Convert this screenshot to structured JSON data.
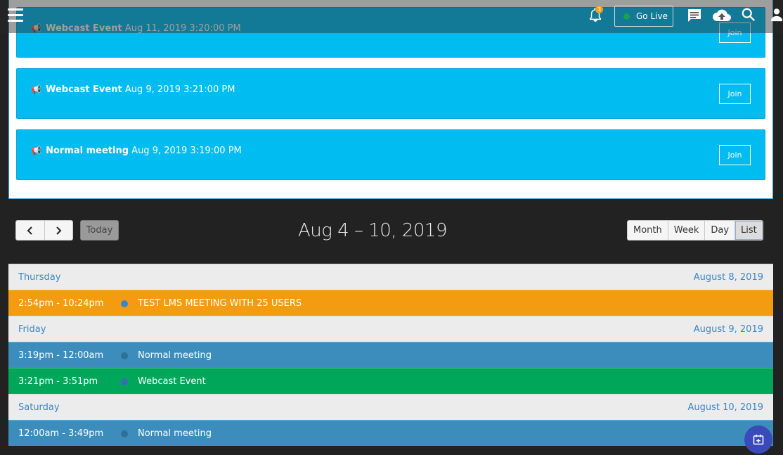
{
  "topbar": {
    "notification_count": "3",
    "go_live_label": "Go Live",
    "icons": [
      "menu-icon",
      "bell-icon",
      "chat-icon",
      "cloud-upload-icon",
      "search-icon",
      "user-icon"
    ]
  },
  "events": [
    {
      "title": "Webcast Event",
      "datetime": "Aug 11, 2019 3:20:00 PM",
      "join_label": "Join"
    },
    {
      "title": "Webcast Event",
      "datetime": "Aug 9, 2019 3:21:00 PM",
      "join_label": "Join"
    },
    {
      "title": "Normal meeting",
      "datetime": "Aug 9, 2019 3:19:00 PM",
      "join_label": "Join"
    }
  ],
  "calendar": {
    "today_label": "Today",
    "range_title": "Aug 4 – 10, 2019",
    "views": [
      "Month",
      "Week",
      "Day",
      "List"
    ],
    "active_view": "List",
    "days": [
      {
        "name": "Thursday",
        "date": "August 8, 2019",
        "events": [
          {
            "time": "2:54pm - 10:24pm",
            "title": "TEST LMS MEETING WITH 25 USERS",
            "color": "#f39c12",
            "dot": "#3a87c6"
          }
        ]
      },
      {
        "name": "Friday",
        "date": "August 9, 2019",
        "events": [
          {
            "time": "3:19pm - 12:00am",
            "title": "Normal meeting",
            "color": "#3c8dbc",
            "dot": "#2f6f99"
          },
          {
            "time": "3:21pm - 3:51pm",
            "title": "Webcast Event",
            "color": "#00a65a",
            "dot": "#3a6fae"
          }
        ]
      },
      {
        "name": "Saturday",
        "date": "August 10, 2019",
        "events": [
          {
            "time": "12:00am - 3:49pm",
            "title": "Normal meeting",
            "color": "#3c8dbc",
            "dot": "#2f6f99"
          }
        ]
      }
    ]
  },
  "colors": {
    "event_card": "#00bcf0",
    "background": "#222222",
    "fab": "#3a4ab8"
  }
}
